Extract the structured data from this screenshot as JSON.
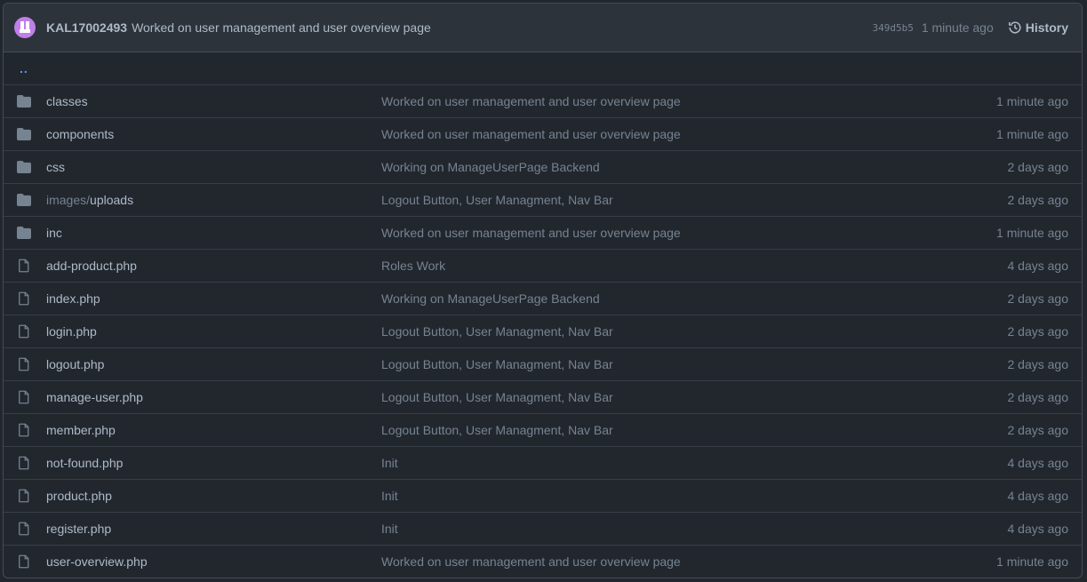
{
  "header": {
    "author": "KAL17002493",
    "message": "Worked on user management and user overview page",
    "sha": "349d5b5",
    "time": "1 minute ago",
    "history_label": "History"
  },
  "parent_link": "..",
  "colors": {
    "background": "#22272e",
    "header_bg": "#2d333b",
    "border": "#444c56",
    "link": "#539bf5",
    "text": "#adbac7",
    "muted": "#768390",
    "icon": "#768390"
  },
  "files": [
    {
      "type": "folder",
      "prefix": "",
      "name": "classes",
      "commit": "Worked on user management and user overview page",
      "age": "1 minute ago"
    },
    {
      "type": "folder",
      "prefix": "",
      "name": "components",
      "commit": "Worked on user management and user overview page",
      "age": "1 minute ago"
    },
    {
      "type": "folder",
      "prefix": "",
      "name": "css",
      "commit": "Working on ManageUserPage Backend",
      "age": "2 days ago"
    },
    {
      "type": "folder",
      "prefix": "images/",
      "name": "uploads",
      "commit": "Logout Button, User Managment, Nav Bar",
      "age": "2 days ago"
    },
    {
      "type": "folder",
      "prefix": "",
      "name": "inc",
      "commit": "Worked on user management and user overview page",
      "age": "1 minute ago"
    },
    {
      "type": "file",
      "prefix": "",
      "name": "add-product.php",
      "commit": "Roles Work",
      "age": "4 days ago"
    },
    {
      "type": "file",
      "prefix": "",
      "name": "index.php",
      "commit": "Working on ManageUserPage Backend",
      "age": "2 days ago"
    },
    {
      "type": "file",
      "prefix": "",
      "name": "login.php",
      "commit": "Logout Button, User Managment, Nav Bar",
      "age": "2 days ago"
    },
    {
      "type": "file",
      "prefix": "",
      "name": "logout.php",
      "commit": "Logout Button, User Managment, Nav Bar",
      "age": "2 days ago"
    },
    {
      "type": "file",
      "prefix": "",
      "name": "manage-user.php",
      "commit": "Logout Button, User Managment, Nav Bar",
      "age": "2 days ago"
    },
    {
      "type": "file",
      "prefix": "",
      "name": "member.php",
      "commit": "Logout Button, User Managment, Nav Bar",
      "age": "2 days ago"
    },
    {
      "type": "file",
      "prefix": "",
      "name": "not-found.php",
      "commit": "Init",
      "age": "4 days ago"
    },
    {
      "type": "file",
      "prefix": "",
      "name": "product.php",
      "commit": "Init",
      "age": "4 days ago"
    },
    {
      "type": "file",
      "prefix": "",
      "name": "register.php",
      "commit": "Init",
      "age": "4 days ago"
    },
    {
      "type": "file",
      "prefix": "",
      "name": "user-overview.php",
      "commit": "Worked on user management and user overview page",
      "age": "1 minute ago"
    }
  ]
}
